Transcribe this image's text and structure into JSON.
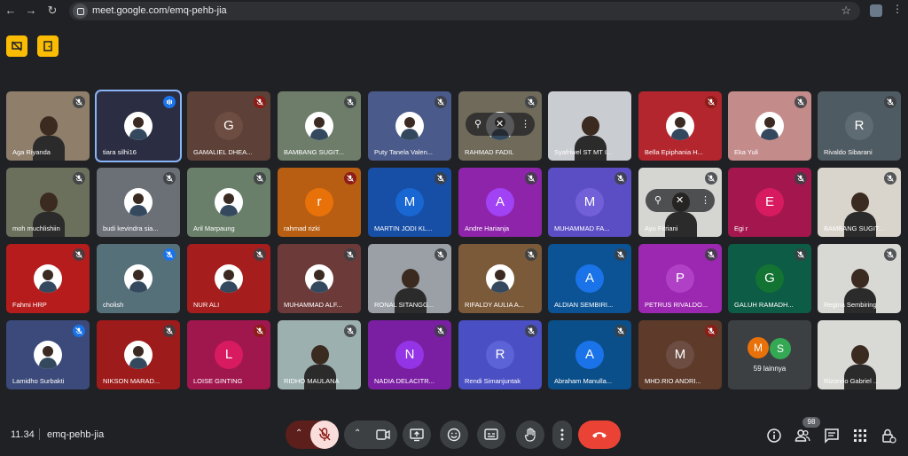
{
  "browser": {
    "url": "meet.google.com/emq-pehb-jia"
  },
  "meeting": {
    "time": "11.34",
    "code": "emq-pehb-jia",
    "participant_count": "98"
  },
  "participants": [
    {
      "name": "Aga Riyanda",
      "initial": "",
      "bg": "#8e7e6a",
      "mic": "muted",
      "kind": "video"
    },
    {
      "name": "tiara silhi16",
      "initial": "",
      "bg": "#2b2d42",
      "mic": "speaking",
      "kind": "pic"
    },
    {
      "name": "GAMALIEL DHEA...",
      "initial": "G",
      "bg": "#5d4037",
      "mic": "muted-red",
      "kind": "letter",
      "avatar_bg": "#6d4c41"
    },
    {
      "name": "BAMBANG SUGIT...",
      "initial": "",
      "bg": "#6e7d6a",
      "mic": "muted",
      "kind": "pic"
    },
    {
      "name": "Puty Tanela Valen...",
      "initial": "",
      "bg": "#4a5a8a",
      "mic": "muted",
      "kind": "pic"
    },
    {
      "name": "RAHMAD FADIL",
      "initial": "",
      "bg": "#6f6a5a",
      "mic": "muted",
      "kind": "pic",
      "overlay": true
    },
    {
      "name": "Syafriwel ST MT I...",
      "initial": "",
      "bg": "#c9ccd0",
      "mic": "none",
      "kind": "video"
    },
    {
      "name": "Bella Epiphania H...",
      "initial": "",
      "bg": "#b3262e",
      "mic": "muted-red",
      "kind": "pic"
    },
    {
      "name": "Eka Yuli",
      "initial": "",
      "bg": "#c48b8b",
      "mic": "muted",
      "kind": "pic"
    },
    {
      "name": "Rivaldo Sibarani",
      "initial": "R",
      "bg": "#4f5b62",
      "mic": "muted",
      "kind": "letter",
      "avatar_bg": "#5f6b72"
    },
    {
      "name": "moh muchlishiin",
      "initial": "",
      "bg": "#6b705c",
      "mic": "muted",
      "kind": "video"
    },
    {
      "name": "budi kevindra sia...",
      "initial": "",
      "bg": "#6b7077",
      "mic": "muted",
      "kind": "pic"
    },
    {
      "name": "Aril Marpaung",
      "initial": "",
      "bg": "#6a7f6a",
      "mic": "muted",
      "kind": "pic"
    },
    {
      "name": "rahmad rizki",
      "initial": "r",
      "bg": "#b85e12",
      "mic": "muted-red",
      "kind": "letter",
      "avatar_bg": "#e8710a"
    },
    {
      "name": "MARTIN JODI KL...",
      "initial": "M",
      "bg": "#174ea6",
      "mic": "muted",
      "kind": "letter",
      "avatar_bg": "#1967d2"
    },
    {
      "name": "Andre Harianja",
      "initial": "A",
      "bg": "#8e24aa",
      "mic": "muted",
      "kind": "letter",
      "avatar_bg": "#a142f4"
    },
    {
      "name": "MUHAMMAD FA...",
      "initial": "M",
      "bg": "#5b4ec5",
      "mic": "muted",
      "kind": "letter",
      "avatar_bg": "#7260d8"
    },
    {
      "name": "Ayu Fitriani",
      "initial": "",
      "bg": "#d5d5d2",
      "mic": "muted",
      "kind": "video",
      "overlay": true
    },
    {
      "name": "Egi r",
      "initial": "E",
      "bg": "#a3174e",
      "mic": "muted",
      "kind": "letter",
      "avatar_bg": "#d81b60"
    },
    {
      "name": "BAMBANG SUGIT...",
      "initial": "",
      "bg": "#d9d4cc",
      "mic": "muted",
      "kind": "video"
    },
    {
      "name": "Fahmi HRP",
      "initial": "",
      "bg": "#b71c1c",
      "mic": "muted",
      "kind": "pic"
    },
    {
      "name": "cholish",
      "initial": "",
      "bg": "#56707a",
      "mic": "muted-blue",
      "kind": "pic"
    },
    {
      "name": "NUR ALI",
      "initial": "",
      "bg": "#a51d1d",
      "mic": "muted",
      "kind": "pic"
    },
    {
      "name": "MUHAMMAD ALF...",
      "initial": "",
      "bg": "#6d3a3a",
      "mic": "muted",
      "kind": "pic"
    },
    {
      "name": "RONAL SITANGG...",
      "initial": "",
      "bg": "#9aa0a6",
      "mic": "muted",
      "kind": "video"
    },
    {
      "name": "RIFALDY AULIA A...",
      "initial": "",
      "bg": "#7b5a3a",
      "mic": "muted",
      "kind": "pic"
    },
    {
      "name": "ALDIAN SEMBIRI...",
      "initial": "A",
      "bg": "#0b5394",
      "mic": "muted",
      "kind": "letter",
      "avatar_bg": "#1a73e8"
    },
    {
      "name": "PETRUS RIVALDO...",
      "initial": "P",
      "bg": "#9c27b0",
      "mic": "muted",
      "kind": "letter",
      "avatar_bg": "#b041c7"
    },
    {
      "name": "GALUH RAMADH...",
      "initial": "G",
      "bg": "#0d5c45",
      "mic": "muted",
      "kind": "letter",
      "avatar_bg": "#137333"
    },
    {
      "name": "Regina Sembiring",
      "initial": "",
      "bg": "#d8d8d4",
      "mic": "muted",
      "kind": "video"
    },
    {
      "name": "Lamidho Surbakti",
      "initial": "",
      "bg": "#3b4a7a",
      "mic": "muted-blue",
      "kind": "pic"
    },
    {
      "name": "NIKSON MARAD...",
      "initial": "",
      "bg": "#9e1b1b",
      "mic": "muted",
      "kind": "pic"
    },
    {
      "name": "LOISE GINTING",
      "initial": "L",
      "bg": "#a0174e",
      "mic": "muted-red",
      "kind": "letter",
      "avatar_bg": "#d81b60"
    },
    {
      "name": "RIDHO MAULANA",
      "initial": "",
      "bg": "#9db0b0",
      "mic": "muted",
      "kind": "video"
    },
    {
      "name": "NADIA DELACITR...",
      "initial": "N",
      "bg": "#7b1fa2",
      "mic": "muted",
      "kind": "letter",
      "avatar_bg": "#9334e6"
    },
    {
      "name": "Rendi Simanjuntak",
      "initial": "R",
      "bg": "#4a4fc4",
      "mic": "muted",
      "kind": "letter",
      "avatar_bg": "#5c63d6"
    },
    {
      "name": "Abraham Manulla...",
      "initial": "A",
      "bg": "#0b4f8a",
      "mic": "muted",
      "kind": "letter",
      "avatar_bg": "#1a73e8"
    },
    {
      "name": "MHD.RIO ANDRI...",
      "initial": "M",
      "bg": "#5d3a2a",
      "mic": "muted-red",
      "kind": "letter",
      "avatar_bg": "#6d4c41"
    },
    {
      "name": "",
      "initial": "",
      "bg": "#3c4043",
      "mic": "none",
      "kind": "more"
    },
    {
      "name": "Rizonrio Gabriel ...",
      "initial": "",
      "bg": "#d9d9d6",
      "mic": "none",
      "kind": "video"
    }
  ],
  "more_tile": {
    "initial_1": "M",
    "initial_2": "S",
    "label": "59 lainnya"
  }
}
